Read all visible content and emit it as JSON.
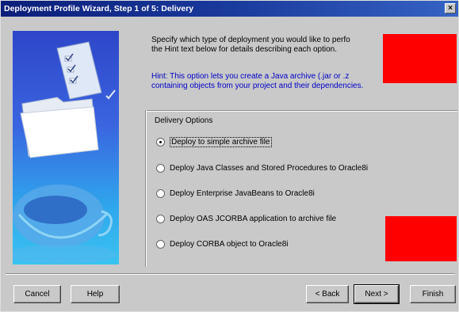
{
  "window": {
    "title": "Deployment Profile Wizard, Step 1 of 5: Delivery",
    "close_glyph": "×"
  },
  "intro": {
    "text": "Specify which type of deployment you would like to perfo... the Hint text below for details describing each option.",
    "line1": "Specify which type of deployment you would like to perfo",
    "line2": "the Hint text below for details describing each option."
  },
  "hint": {
    "line1": "Hint:  This option lets you create a Java archive (.jar or .z",
    "line2": "containing objects from your project and their dependencies."
  },
  "delivery": {
    "group_label": "Delivery Options",
    "options": [
      {
        "label": "Deploy to simple archive file",
        "checked": true
      },
      {
        "label": "Deploy Java Classes and Stored Procedures to Oracle8i",
        "checked": false
      },
      {
        "label": "Deploy Enterprise JavaBeans to Oracle8i",
        "checked": false
      },
      {
        "label": "Deploy OAS JCORBA application to archive file",
        "checked": false
      },
      {
        "label": "Deploy CORBA object to Oracle8i",
        "checked": false
      }
    ]
  },
  "buttons": {
    "cancel": "Cancel",
    "help": "Help",
    "back": "< Back",
    "next": "Next >",
    "finish": "Finish"
  },
  "colors": {
    "title_bar": "#0b1e7a",
    "graphic_top": "#2e46c9",
    "graphic_bottom": "#3ac3f0",
    "hint_text": "#0000c8",
    "redaction": "#ff0000"
  },
  "icons": {
    "graphic": [
      "document-checklist-icon",
      "folder-icon",
      "coffee-cup-icon"
    ]
  }
}
